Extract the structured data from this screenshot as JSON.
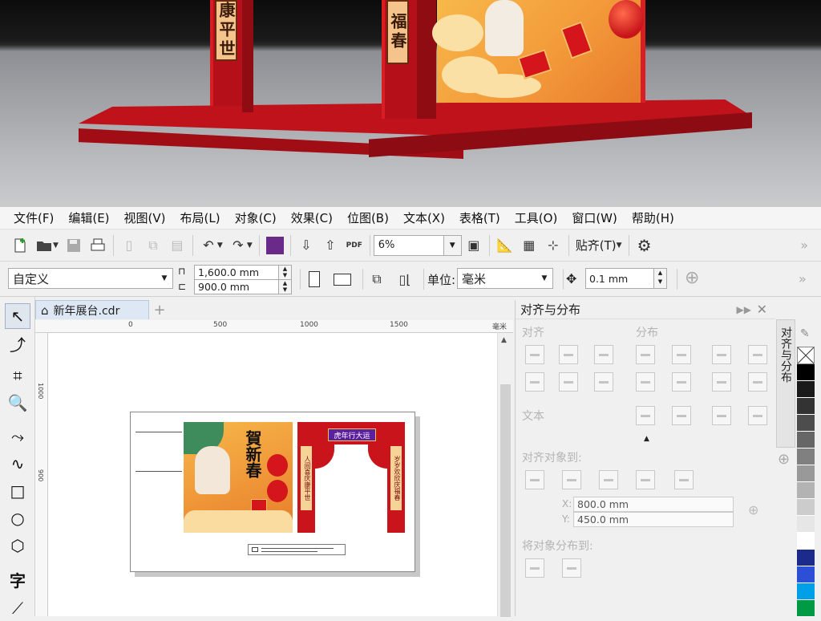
{
  "render": {
    "left_pillar_sign": "康平世",
    "right_pillar_sign": "福春"
  },
  "menu": [
    "文件(F)",
    "编辑(E)",
    "视图(V)",
    "布局(L)",
    "对象(C)",
    "效果(C)",
    "位图(B)",
    "文本(X)",
    "表格(T)",
    "工具(O)",
    "窗口(W)",
    "帮助(H)"
  ],
  "toolbar": {
    "zoom": "6%",
    "snap_label": "贴齐(T)",
    "more": "»"
  },
  "property_bar": {
    "page_preset": "自定义",
    "width": "1,600.0 mm",
    "height": "900.0 mm",
    "unit_label": "单位:",
    "unit_value": "毫米",
    "nudge": "0.1 mm",
    "more": "»"
  },
  "document": {
    "tab_title": "新年展台.cdr",
    "add_tab": "+",
    "ruler_ticks": [
      "0",
      "500",
      "1000",
      "1500"
    ],
    "ruler_unit": "毫米",
    "left_ruler_ticks": [
      "1000",
      "900"
    ],
    "art_left_title": "賀新春",
    "art_right_banner": "虎年行大运",
    "art_right_col_left": "人间喜庆康平世",
    "art_right_col_right": "岁岁欢欣庆福春"
  },
  "docker": {
    "title": "对齐与分布",
    "section_align": "对齐",
    "section_distribute": "分布",
    "section_text": "文本",
    "section_align_to": "对齐对象到:",
    "x_label": "X:",
    "x_value": "800.0 mm",
    "y_label": "Y:",
    "y_value": "450.0 mm",
    "section_distribute_to": "将对象分布到:",
    "side_tab": "对齐与分布"
  },
  "palette": {
    "colors": [
      "#ffffff",
      "#000000",
      "#1a1a1a",
      "#333333",
      "#4d4d4d",
      "#666666",
      "#808080",
      "#999999",
      "#b3b3b3",
      "#cccccc",
      "#e6e6e6",
      "#ffffff",
      "#1c2a8c",
      "#2d4fd6",
      "#00a0e9",
      "#009944"
    ]
  }
}
